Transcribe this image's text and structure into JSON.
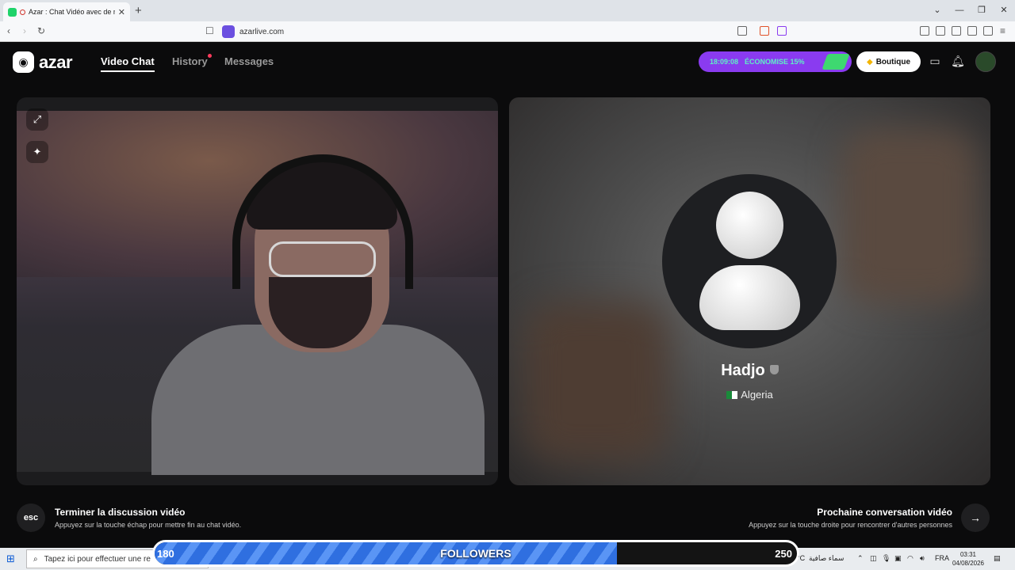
{
  "browser": {
    "tab_title": "Azar : Chat Vidéo avec de no",
    "url": "azarlive.com"
  },
  "app": {
    "logo_text": "azar",
    "nav": [
      "Video Chat",
      "History",
      "Messages"
    ],
    "promo": {
      "time": "18:09:08",
      "saving": "ÉCONOMISE 15%"
    },
    "shop_label": "Boutique"
  },
  "partner": {
    "name": "Hadjo",
    "country": "Algeria"
  },
  "hints": {
    "esc_key": "esc",
    "end_title": "Terminer la discussion vidéo",
    "end_sub": "Appuyez sur la touche échap pour mettre fin au chat vidéo.",
    "next_title": "Prochaine conversation vidéo",
    "next_sub": "Appuyez sur la touche droite pour rencontrer d'autres personnes"
  },
  "followers": {
    "label": "FOLLOWERS",
    "current": "180",
    "goal": "250",
    "progress": 0.72
  },
  "taskbar": {
    "search_placeholder": "Tapez ici pour effectuer une re",
    "temp": "25°C",
    "weather": "سماء صافية",
    "lang": "FRA",
    "time": "03:31",
    "date": "04/08/2026"
  },
  "colors": {
    "accent_purple": "#8a3bf0",
    "mint": "#5ef0c5",
    "followers_blue": "#2f6fe0"
  }
}
